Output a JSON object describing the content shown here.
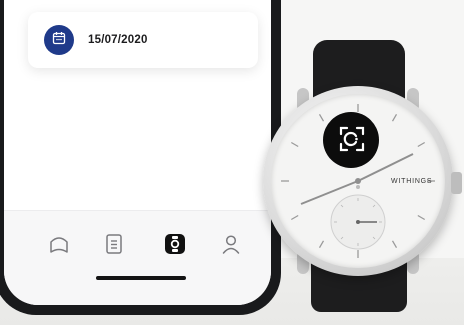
{
  "phone": {
    "date_card": {
      "icon": "calendar-icon",
      "date": "15/07/2020"
    },
    "tab_bar": {
      "tabs": [
        {
          "icon": "home-icon",
          "active": false
        },
        {
          "icon": "document-icon",
          "active": false
        },
        {
          "icon": "watch-icon",
          "active": true
        },
        {
          "icon": "profile-icon",
          "active": false
        }
      ]
    }
  },
  "watch": {
    "brand": "WITHINGS",
    "icon": "focus-sync-icon"
  },
  "colors": {
    "accent": "#1f3a8a",
    "text": "#1c1c1e",
    "strap": "#1d1d1e"
  }
}
